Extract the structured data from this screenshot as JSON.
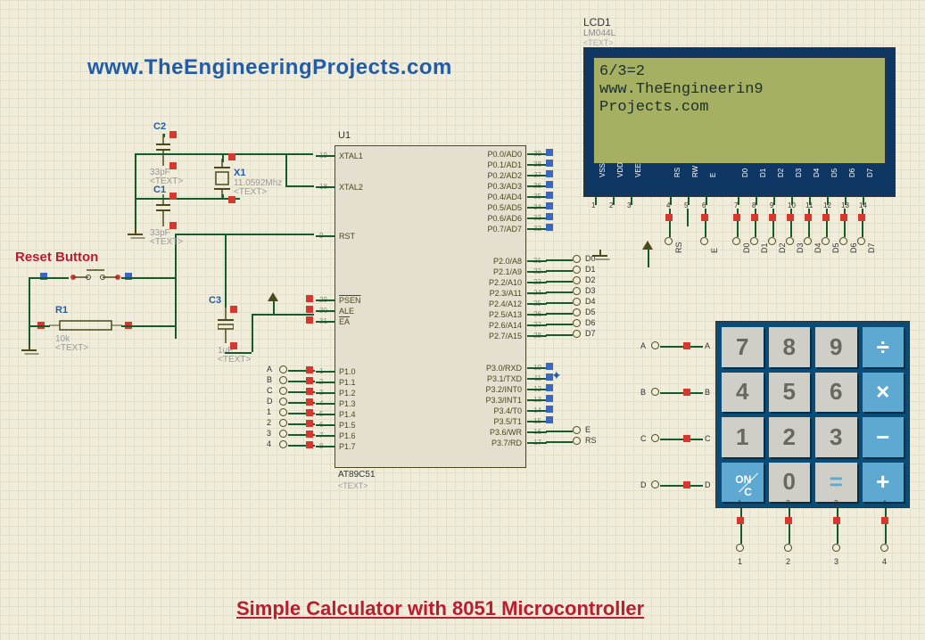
{
  "header": {
    "url": "www.TheEngineeringProjects.com"
  },
  "footer": {
    "title": "Simple Calculator with 8051 Microcontroller"
  },
  "reset_label": "Reset Button",
  "lcd": {
    "ref": "LCD1",
    "part": "LM044L",
    "txt": "<TEXT>",
    "display_line1": "6/3=2",
    "display_line2": "",
    "display_line3": "  www.TheEngineerin9",
    "display_line4": "    Projects.com",
    "pins": [
      "VSS",
      "VDD",
      "VEE",
      "RS",
      "RW",
      "E",
      "D0",
      "D1",
      "D2",
      "D3",
      "D4",
      "D5",
      "D6",
      "D7"
    ],
    "nums": [
      "1",
      "2",
      "3",
      "4",
      "5",
      "6",
      "7",
      "8",
      "9",
      "10",
      "11",
      "12",
      "13",
      "14"
    ]
  },
  "mcu": {
    "ref": "U1",
    "part": "AT89C51",
    "txt": "<TEXT>",
    "left_pins": [
      {
        "n": "19",
        "name": "XTAL1"
      },
      {
        "n": "18",
        "name": "XTAL2"
      },
      {
        "n": "9",
        "name": "RST"
      },
      {
        "n": "29",
        "name": "PSEN",
        "bar": true
      },
      {
        "n": "30",
        "name": "ALE"
      },
      {
        "n": "31",
        "name": "EA",
        "bar": true
      },
      {
        "n": "1",
        "name": "P1.0"
      },
      {
        "n": "2",
        "name": "P1.1"
      },
      {
        "n": "3",
        "name": "P1.2"
      },
      {
        "n": "4",
        "name": "P1.3"
      },
      {
        "n": "5",
        "name": "P1.4"
      },
      {
        "n": "6",
        "name": "P1.5"
      },
      {
        "n": "7",
        "name": "P1.6"
      },
      {
        "n": "8",
        "name": "P1.7"
      }
    ],
    "right_pins": [
      {
        "n": "39",
        "name": "P0.0/AD0"
      },
      {
        "n": "38",
        "name": "P0.1/AD1"
      },
      {
        "n": "37",
        "name": "P0.2/AD2"
      },
      {
        "n": "36",
        "name": "P0.3/AD3"
      },
      {
        "n": "35",
        "name": "P0.4/AD4"
      },
      {
        "n": "34",
        "name": "P0.5/AD5"
      },
      {
        "n": "33",
        "name": "P0.6/AD6"
      },
      {
        "n": "32",
        "name": "P0.7/AD7"
      },
      {
        "n": "21",
        "name": "P2.0/A8"
      },
      {
        "n": "22",
        "name": "P2.1/A9"
      },
      {
        "n": "23",
        "name": "P2.2/A10"
      },
      {
        "n": "24",
        "name": "P2.3/A11"
      },
      {
        "n": "25",
        "name": "P2.4/A12"
      },
      {
        "n": "26",
        "name": "P2.5/A13"
      },
      {
        "n": "27",
        "name": "P2.6/A14"
      },
      {
        "n": "28",
        "name": "P2.7/A15"
      },
      {
        "n": "10",
        "name": "P3.0/RXD"
      },
      {
        "n": "11",
        "name": "P3.1/TXD"
      },
      {
        "n": "12",
        "name": "P3.2/INT0"
      },
      {
        "n": "13",
        "name": "P3.3/INT1"
      },
      {
        "n": "14",
        "name": "P3.4/T0"
      },
      {
        "n": "15",
        "name": "P3.5/T1"
      },
      {
        "n": "16",
        "name": "P3.6/WR"
      },
      {
        "n": "17",
        "name": "P3.7/RD"
      }
    ]
  },
  "net_labels_p2": [
    "D0",
    "D1",
    "D2",
    "D3",
    "D4",
    "D5",
    "D6",
    "D7"
  ],
  "net_labels_p1": [
    "A",
    "B",
    "C",
    "D",
    "1",
    "2",
    "3",
    "4"
  ],
  "net_labels_p3": [
    "E",
    "RS"
  ],
  "components": {
    "C1": {
      "ref": "C1",
      "val": "33pF",
      "txt": "<TEXT>"
    },
    "C2": {
      "ref": "C2",
      "val": "33pF",
      "txt": "<TEXT>"
    },
    "C3": {
      "ref": "C3",
      "val": "1uF",
      "txt": "<TEXT>"
    },
    "X1": {
      "ref": "X1",
      "val": "11.0592Mhz",
      "txt": "<TEXT>"
    },
    "R1": {
      "ref": "R1",
      "val": "10k",
      "txt": "<TEXT>"
    }
  },
  "keypad": {
    "rows": [
      "A",
      "B",
      "C",
      "D"
    ],
    "cols": [
      "1",
      "2",
      "3",
      "4"
    ],
    "keys": [
      [
        "7",
        "8",
        "9",
        "÷"
      ],
      [
        "4",
        "5",
        "6",
        "×"
      ],
      [
        "1",
        "2",
        "3",
        "−"
      ],
      [
        "ON/C",
        "0",
        "=",
        "+"
      ]
    ]
  },
  "lcd_bus": {
    "left": [
      "RS",
      "E"
    ],
    "data": [
      "D0",
      "D1",
      "D2",
      "D3",
      "D4",
      "D5",
      "D6",
      "D7"
    ]
  }
}
